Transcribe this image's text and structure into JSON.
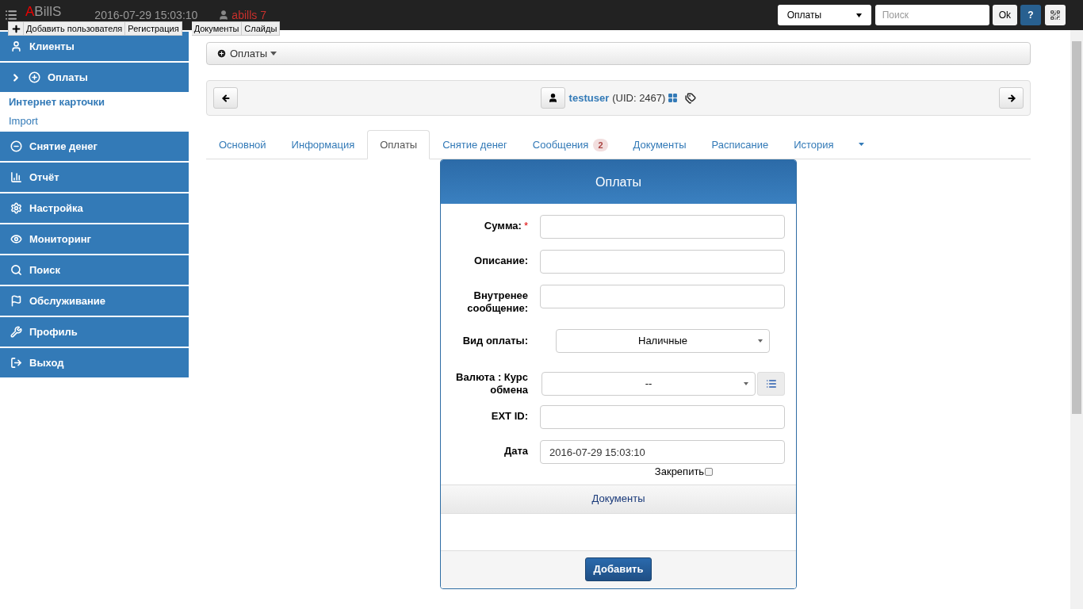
{
  "topbar": {
    "logo_accent": "A",
    "logo_rest": "BillS",
    "datetime": "2016-07-29 15:03:10",
    "user": "abills 7",
    "module_select": "Оплаты",
    "search": {
      "placeholder": "Поиск"
    },
    "ok_button": "Ok",
    "help_button": "?"
  },
  "quick_links": [
    "Добавить пользователя",
    "Регистрация",
    "Документы",
    "Слайды"
  ],
  "sidebar": [
    {
      "kind": "menu",
      "label": "Клиенты"
    },
    {
      "kind": "menu",
      "label": "Оплаты",
      "expanded": true
    },
    {
      "kind": "sub",
      "label": "Интернет карточки",
      "selected": true
    },
    {
      "kind": "sub",
      "label": "Import",
      "selected": false
    },
    {
      "kind": "menu",
      "label": "Снятие денег"
    },
    {
      "kind": "menu",
      "label": "Отчёт"
    },
    {
      "kind": "menu",
      "label": "Настройка"
    },
    {
      "kind": "menu",
      "label": "Мониторинг"
    },
    {
      "kind": "menu",
      "label": "Поиск"
    },
    {
      "kind": "menu",
      "label": "Обслуживание"
    },
    {
      "kind": "menu",
      "label": "Профиль"
    },
    {
      "kind": "menu",
      "label": "Выход"
    }
  ],
  "breadcrumb": "Оплаты",
  "user_bar": {
    "login": "testuser",
    "uid": "(UID: 2467)"
  },
  "tabs": [
    {
      "label": "Основной",
      "selected": false
    },
    {
      "label": "Информация",
      "selected": false
    },
    {
      "label": "Оплаты",
      "selected": true
    },
    {
      "label": "Снятие денег",
      "selected": false
    },
    {
      "label": "Сообщения",
      "selected": false,
      "badge": "2"
    },
    {
      "label": "Документы",
      "selected": false
    },
    {
      "label": "Расписание",
      "selected": false
    },
    {
      "label": "История",
      "selected": false
    }
  ],
  "form": {
    "title": "Оплаты",
    "fields": [
      {
        "kind": "input",
        "label": "Сумма:",
        "required_mark": "*"
      },
      {
        "kind": "input",
        "label": "Описание:"
      },
      {
        "kind": "input",
        "label": "Внутренее сообщение:"
      },
      {
        "kind": "select",
        "label": "Вид оплаты:",
        "value": "Наличные"
      },
      {
        "kind": "select_button",
        "label": "Валюта : Курс обмена",
        "value": "--"
      },
      {
        "kind": "input",
        "label": "EXT ID:"
      },
      {
        "kind": "input",
        "label": "Дата",
        "value": "2016-07-29 15:03:10"
      }
    ],
    "pin": {
      "label": "Закрепить",
      "checked": false
    },
    "section": "Документы",
    "submit": "Добавить"
  }
}
